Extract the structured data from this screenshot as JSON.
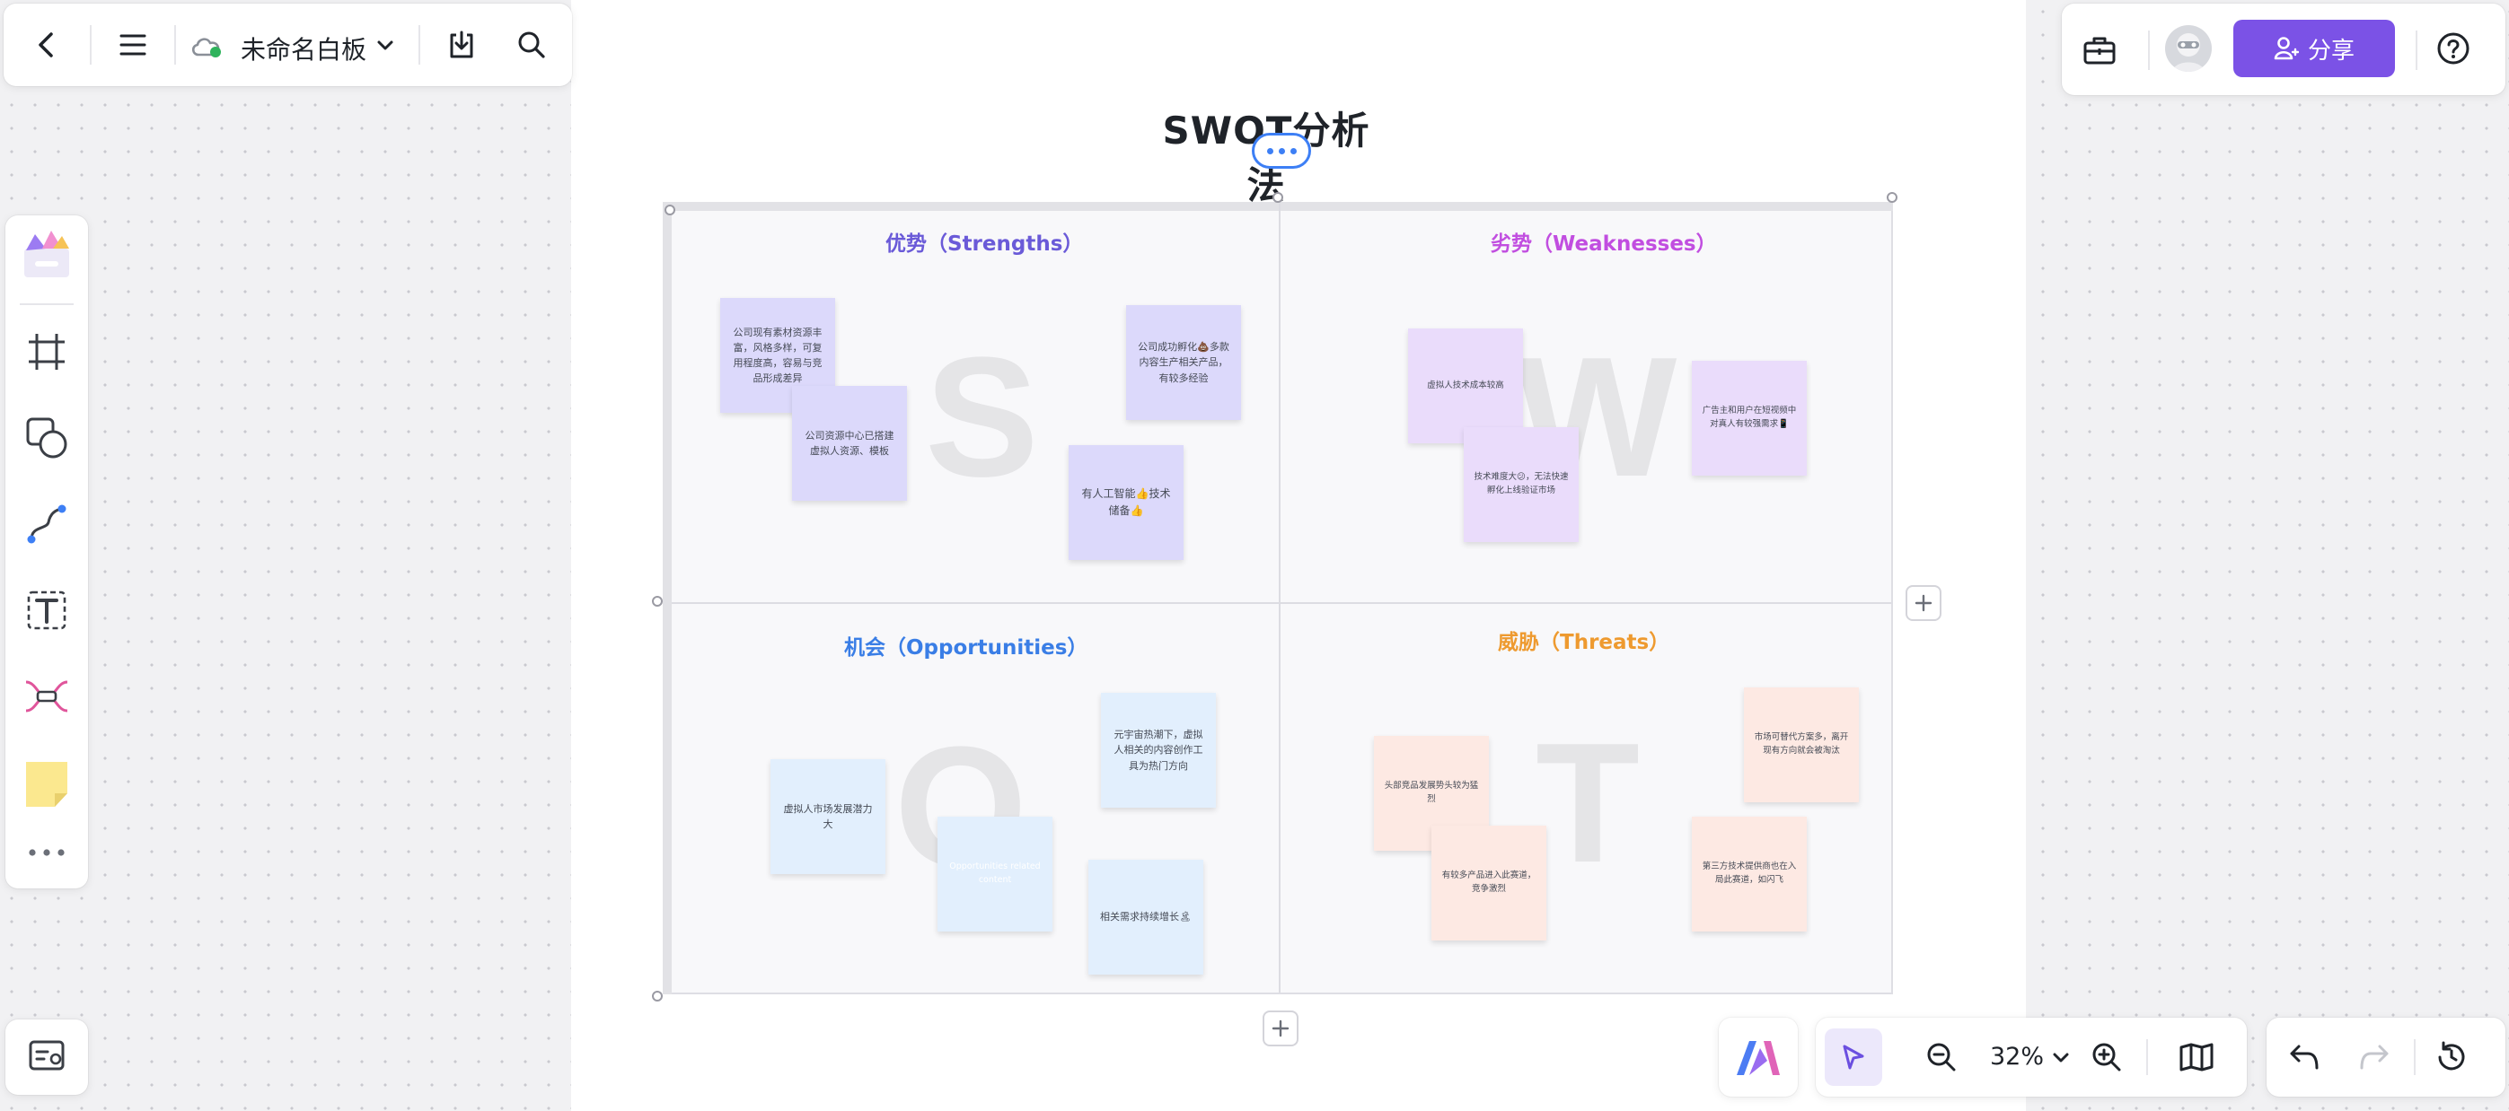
{
  "header": {
    "doc_title": "未命名白板",
    "share_label": "分享"
  },
  "board": {
    "title": "SWOT分析法",
    "quadrants": {
      "strengths": {
        "title": "优势（Strengths）",
        "letter": "S",
        "color": "#6a5ad8",
        "notes": [
          "公司现有素材资源丰富，风格多样，可复用程度高，容易与竞品形成差异",
          "公司资源中心已搭建虚拟人资源、模板",
          "公司成功孵化💩多款内容生产相关产品，有较多经验",
          "有人工智能👍技术储备👍"
        ]
      },
      "weaknesses": {
        "title": "劣势（Weaknesses）",
        "letter": "W",
        "color": "#c14ee0",
        "notes": [
          "虚拟人技术成本较高",
          "技术难度大😕，无法快速孵化上线验证市场",
          "广告主和用户在短视频中对真人有较强需求📱"
        ]
      },
      "opportunities": {
        "title": "机会（Opportunities）",
        "letter": "O",
        "color": "#3a7ee6",
        "notes": [
          "虚拟人市场发展潜力大",
          "Opportunities related content",
          "元宇宙热潮下，虚拟人相关的内容创作工具为热门方向",
          "相关需求持续增长🏝"
        ]
      },
      "threats": {
        "title": "威胁（Threats）",
        "letter": "T",
        "color": "#ee9a2f",
        "notes": [
          "头部竞品发展势头较为猛烈",
          "有较多产品进入此赛道，竞争激烈",
          "市场可替代方案多，离开现有方向就会被淘汰",
          "第三方技术提供商也在入局此赛道，如闪飞"
        ]
      }
    }
  },
  "zoom": {
    "level": "32%"
  },
  "colors": {
    "accent": "#7b52e6",
    "selection": "#3d7ff5"
  }
}
